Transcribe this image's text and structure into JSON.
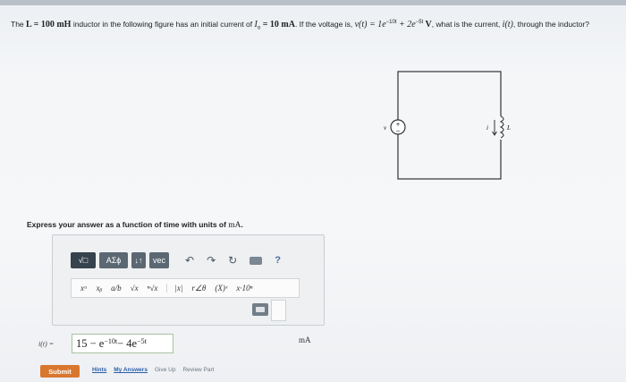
{
  "question": {
    "part1": "The ",
    "L_expr": "L = 100 mH",
    "part2": " inductor in the following figure has an initial current of ",
    "I_expr": "I",
    "I_sub": "o",
    "I_val": " = 10 mA",
    "part3": ". If the voltage is, ",
    "v_expr": "v(t) = 1e",
    "exp1": "−10t",
    "plus": " + 2e",
    "exp2": "−5t",
    "v_unit": " V",
    "part4": ", what is the current, ",
    "i_expr": "i(t)",
    "part5": ", through the inductor?"
  },
  "circuit": {
    "source_label": "v",
    "plus": "+",
    "minus": "−",
    "current_label": "i",
    "inductor_label": "L"
  },
  "prompt": {
    "text": "Express your answer as a function of time with units of ",
    "unit": "mA",
    "end": "."
  },
  "toolbar1": {
    "templates": "√□",
    "greek": "ΑΣϕ",
    "arrows": "↓↑",
    "vec": "vec",
    "undo": "↶",
    "redo": "↷",
    "reset": "↻",
    "help": "?"
  },
  "toolbar2": [
    "xᵃ",
    "xᵦ",
    "a/b",
    "√x",
    "ⁿ√x",
    "|x|",
    "r∠θ",
    "(X)ˣ",
    "x·10ⁿ"
  ],
  "answer": {
    "label": "i(t) =",
    "base1": "15 − e",
    "exp1": "−10t",
    "base2": " − 4e",
    "exp2": "−5t",
    "unit": "mA"
  },
  "actions": {
    "submit": "Submit",
    "hints": "Hints",
    "my_answers": "My Answers",
    "give_up": "Give Up",
    "review_part": "Review Part"
  }
}
